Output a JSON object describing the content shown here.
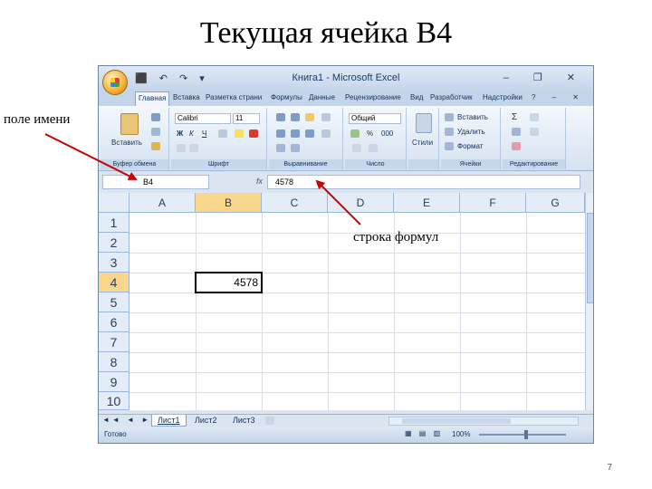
{
  "slide": {
    "title": "Текущая ячейка B4",
    "annotation_namebox": "поле имени",
    "annotation_formula": "строка формул",
    "page_number": "7"
  },
  "window": {
    "title": "Книга1 - Microsoft Excel",
    "quick_access": "⬛ ↶ ↷ ▾",
    "controls": "– ❐ ✕"
  },
  "ribbon_tabs": {
    "items": [
      "Главная",
      "Вставка",
      "Разметка страни",
      "Формулы",
      "Данные",
      "Рецензирование",
      "Вид",
      "Разработчик",
      "Надстройки"
    ],
    "right": "? – ✕"
  },
  "ribbon": {
    "clipboard": {
      "label": "Буфер обмена",
      "paste": "Вставить"
    },
    "font": {
      "label": "Шрифт",
      "name": "Calibri",
      "size": "11"
    },
    "alignment": {
      "label": "Выравнивание"
    },
    "number": {
      "label": "Число",
      "format": "Общий",
      "pct": "%",
      "thousands": "000"
    },
    "styles": {
      "label": "Стили"
    },
    "cells": {
      "label": "Ячейки",
      "insert": "Вставить",
      "delete": "Удалить",
      "format": "Формат"
    },
    "editing": {
      "label": "Редактирование"
    }
  },
  "formula_bar": {
    "name_box": "B4",
    "fx": "fx",
    "value": "4578"
  },
  "grid": {
    "columns": [
      "A",
      "B",
      "C",
      "D",
      "E",
      "F",
      "G"
    ],
    "rows": [
      "1",
      "2",
      "3",
      "4",
      "5",
      "6",
      "7",
      "8",
      "9",
      "10"
    ],
    "active_cell_value": "4578"
  },
  "sheets": {
    "nav": "◄◄ ◄ ► ►►",
    "tabs": [
      "Лист1",
      "Лист2",
      "Лист3"
    ]
  },
  "status": {
    "text": "Готово",
    "zoom": "100%"
  },
  "colors": {
    "annotation_arrow": "#cc0000",
    "selected_header": "#f8d68b"
  }
}
